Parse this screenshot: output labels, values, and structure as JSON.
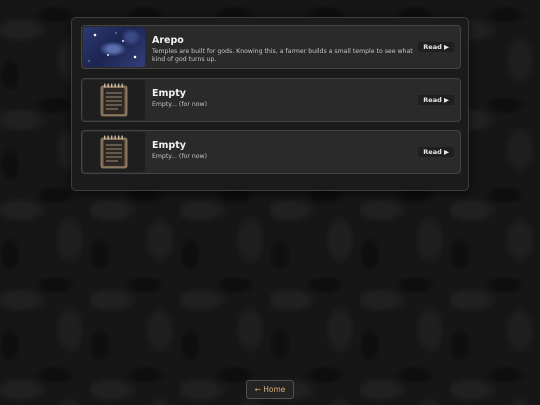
{
  "stories": [
    {
      "title": "Arepo",
      "description": "Temples are built for gods. Knowing this, a farmer builds a small temple to see what kind of god turns up.",
      "read_label": "Read ▶",
      "thumbnail_icon": "starry-art-thumbnail"
    },
    {
      "title": "Empty",
      "description": "Empty... (for now)",
      "read_label": "Read ▶",
      "thumbnail_icon": "notepad-icon"
    },
    {
      "title": "Empty",
      "description": "Empty... (for now)",
      "read_label": "Read ▶",
      "thumbnail_icon": "notepad-icon"
    }
  ],
  "home_button": {
    "label": "← Home"
  },
  "colors": {
    "background": "#161616",
    "card": "#2a2a2a",
    "home_text": "#d9b07a"
  }
}
